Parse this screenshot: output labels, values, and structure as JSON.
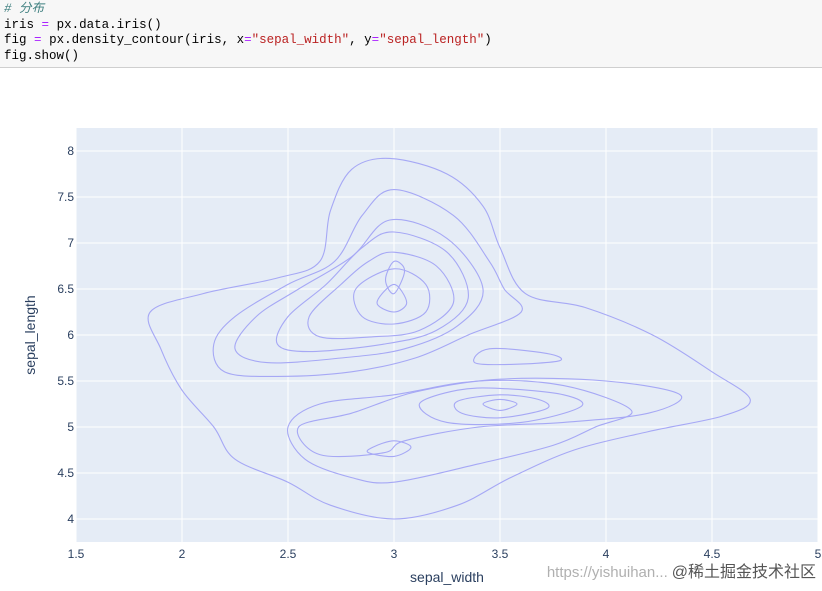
{
  "code": {
    "comment": "# 分布",
    "line1": {
      "var": "iris",
      "op": "=",
      "rest": "px.data.iris()"
    },
    "line2": {
      "prefix": "fig",
      "op": "=",
      "call": "px.density_contour(iris, x",
      "x_val": "\"sepal_width\"",
      "mid": ", y",
      "y_val": "\"sepal_length\"",
      "end": ")"
    },
    "line3": "fig.show()"
  },
  "chart_data": {
    "type": "density_contour",
    "x_column": "sepal_width",
    "y_column": "sepal_length",
    "xlabel": "sepal_width",
    "ylabel": "sepal_length",
    "xlim": [
      1.5,
      5
    ],
    "ylim": [
      3.75,
      8.25
    ],
    "xticks": [
      1.5,
      2,
      2.5,
      3,
      3.5,
      4,
      4.5,
      5
    ],
    "xtick_labels": [
      "1.5",
      "2",
      "2.5",
      "3",
      "3.5",
      "4",
      "4.5",
      "5"
    ],
    "yticks": [
      4,
      4.5,
      5,
      5.5,
      6,
      6.5,
      7,
      7.5,
      8
    ],
    "ytick_labels": [
      "4",
      "4.5",
      "5",
      "5.5",
      "6",
      "6.5",
      "7",
      "7.5",
      "8"
    ],
    "grid": true,
    "line_color": "#a6a8f5",
    "plot_bg": "#e5ecf6",
    "contours": [
      [
        [
          2.98,
          7.92
        ],
        [
          3.25,
          7.75
        ],
        [
          3.42,
          7.4
        ],
        [
          3.5,
          6.95
        ],
        [
          3.62,
          6.45
        ],
        [
          3.9,
          6.3
        ],
        [
          4.22,
          6.0
        ],
        [
          4.5,
          5.6
        ],
        [
          4.68,
          5.3
        ],
        [
          4.55,
          5.12
        ],
        [
          4.2,
          4.95
        ],
        [
          3.85,
          4.75
        ],
        [
          3.55,
          4.45
        ],
        [
          3.3,
          4.15
        ],
        [
          3.0,
          4.0
        ],
        [
          2.7,
          4.15
        ],
        [
          2.5,
          4.4
        ],
        [
          2.25,
          4.65
        ],
        [
          2.15,
          5.0
        ],
        [
          2.0,
          5.4
        ],
        [
          1.9,
          5.85
        ],
        [
          1.85,
          6.25
        ],
        [
          2.1,
          6.45
        ],
        [
          2.45,
          6.62
        ],
        [
          2.65,
          6.8
        ],
        [
          2.7,
          7.35
        ],
        [
          2.8,
          7.8
        ]
      ],
      [
        [
          3.0,
          7.58
        ],
        [
          3.28,
          7.3
        ],
        [
          3.45,
          6.8
        ],
        [
          3.52,
          6.5
        ],
        [
          3.6,
          6.25
        ],
        [
          3.35,
          6.0
        ],
        [
          3.1,
          5.75
        ],
        [
          2.8,
          5.6
        ],
        [
          2.45,
          5.55
        ],
        [
          2.2,
          5.6
        ],
        [
          2.15,
          5.9
        ],
        [
          2.25,
          6.2
        ],
        [
          2.5,
          6.55
        ],
        [
          2.72,
          6.8
        ],
        [
          2.85,
          7.3
        ]
      ],
      [
        [
          2.98,
          7.25
        ],
        [
          3.25,
          7.05
        ],
        [
          3.42,
          6.5
        ],
        [
          3.3,
          6.1
        ],
        [
          3.05,
          5.85
        ],
        [
          2.75,
          5.75
        ],
        [
          2.4,
          5.7
        ],
        [
          2.25,
          5.85
        ],
        [
          2.35,
          6.2
        ],
        [
          2.55,
          6.5
        ],
        [
          2.8,
          6.85
        ]
      ],
      [
        [
          3.0,
          7.12
        ],
        [
          3.25,
          6.9
        ],
        [
          3.35,
          6.4
        ],
        [
          3.2,
          6.05
        ],
        [
          2.95,
          5.9
        ],
        [
          2.6,
          5.82
        ],
        [
          2.45,
          5.9
        ],
        [
          2.5,
          6.2
        ],
        [
          2.68,
          6.55
        ],
        [
          2.85,
          6.95
        ]
      ],
      [
        [
          3.0,
          6.9
        ],
        [
          3.2,
          6.75
        ],
        [
          3.28,
          6.35
        ],
        [
          3.12,
          6.05
        ],
        [
          2.9,
          5.98
        ],
        [
          2.65,
          5.98
        ],
        [
          2.6,
          6.2
        ],
        [
          2.75,
          6.55
        ],
        [
          2.88,
          6.8
        ]
      ],
      [
        [
          3.0,
          6.72
        ],
        [
          3.15,
          6.55
        ],
        [
          3.15,
          6.25
        ],
        [
          3.0,
          6.12
        ],
        [
          2.85,
          6.2
        ],
        [
          2.82,
          6.5
        ]
      ],
      [
        [
          3.0,
          6.55
        ],
        [
          3.06,
          6.35
        ],
        [
          3.0,
          6.25
        ],
        [
          2.92,
          6.35
        ]
      ],
      [
        [
          3.0,
          6.8
        ],
        [
          3.05,
          6.7
        ],
        [
          3.0,
          6.45
        ],
        [
          2.96,
          6.6
        ]
      ],
      [
        [
          2.95,
          4.72
        ],
        [
          3.05,
          4.85
        ],
        [
          3.4,
          5.0
        ],
        [
          3.8,
          5.05
        ],
        [
          4.2,
          5.15
        ],
        [
          4.35,
          5.35
        ],
        [
          4.0,
          5.5
        ],
        [
          3.5,
          5.52
        ],
        [
          3.1,
          5.38
        ],
        [
          2.8,
          5.15
        ],
        [
          2.55,
          5.0
        ],
        [
          2.65,
          4.7
        ]
      ],
      [
        [
          3.0,
          4.4
        ],
        [
          3.4,
          4.6
        ],
        [
          3.75,
          4.8
        ],
        [
          3.95,
          5.0
        ],
        [
          4.12,
          5.18
        ],
        [
          3.8,
          5.45
        ],
        [
          3.4,
          5.5
        ],
        [
          3.0,
          5.35
        ],
        [
          2.65,
          5.25
        ],
        [
          2.5,
          5.0
        ],
        [
          2.58,
          4.65
        ],
        [
          2.8,
          4.45
        ]
      ],
      [
        [
          3.5,
          5.42
        ],
        [
          3.8,
          5.35
        ],
        [
          3.88,
          5.22
        ],
        [
          3.6,
          5.05
        ],
        [
          3.25,
          5.05
        ],
        [
          3.12,
          5.25
        ],
        [
          3.3,
          5.4
        ]
      ],
      [
        [
          3.5,
          5.35
        ],
        [
          3.68,
          5.3
        ],
        [
          3.72,
          5.2
        ],
        [
          3.5,
          5.1
        ],
        [
          3.32,
          5.15
        ],
        [
          3.3,
          5.28
        ]
      ],
      [
        [
          3.5,
          5.3
        ],
        [
          3.58,
          5.25
        ],
        [
          3.5,
          5.18
        ],
        [
          3.42,
          5.25
        ]
      ],
      [
        [
          3.45,
          5.85
        ],
        [
          3.72,
          5.8
        ],
        [
          3.78,
          5.72
        ],
        [
          3.55,
          5.68
        ],
        [
          3.38,
          5.7
        ]
      ],
      [
        [
          2.9,
          4.78
        ],
        [
          3.0,
          4.85
        ],
        [
          3.08,
          4.78
        ],
        [
          3.0,
          4.68
        ],
        [
          2.88,
          4.72
        ]
      ]
    ]
  }
}
